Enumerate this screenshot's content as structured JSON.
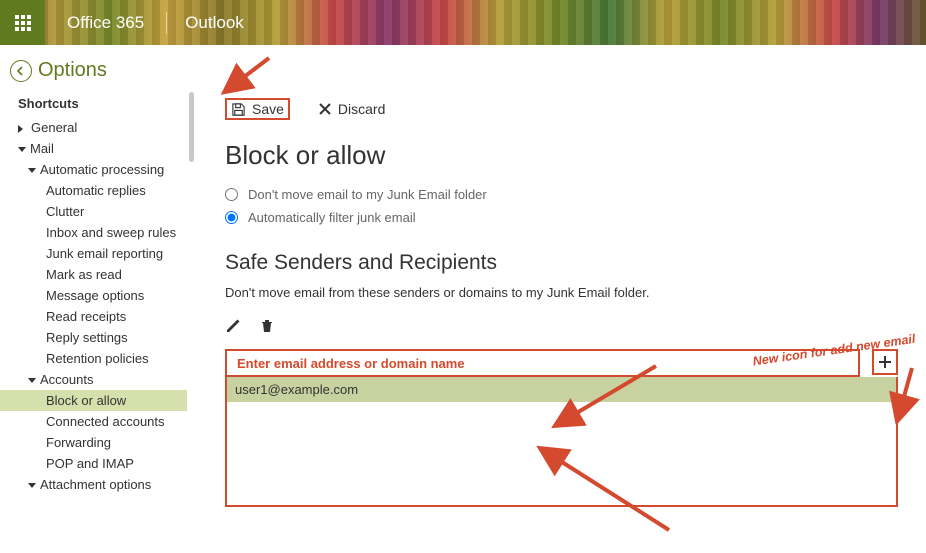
{
  "header": {
    "brand": "Office 365",
    "app": "Outlook"
  },
  "title": "Options",
  "sidebar": {
    "shortcuts_label": "Shortcuts",
    "general_label": "General",
    "mail_label": "Mail",
    "automatic_processing": "Automatic processing",
    "auto_items": [
      "Automatic replies",
      "Clutter",
      "Inbox and sweep rules",
      "Junk email reporting",
      "Mark as read",
      "Message options",
      "Read receipts",
      "Reply settings",
      "Retention policies"
    ],
    "accounts_label": "Accounts",
    "accounts_items": [
      "Block or allow",
      "Connected accounts",
      "Forwarding",
      "POP and IMAP"
    ],
    "attachment_label": "Attachment options"
  },
  "toolbar": {
    "save": "Save",
    "discard": "Discard"
  },
  "section": {
    "title": "Block or allow",
    "radio1": "Don't move email to my Junk Email folder",
    "radio2": "Automatically filter junk email",
    "radio_selected": "2",
    "subhead": "Safe Senders and Recipients",
    "subdesc": "Don't move email from these senders or domains to my Junk Email folder.",
    "input_placeholder": "Enter email address or domain name",
    "list": [
      "user1@example.com"
    ]
  },
  "annotations": {
    "add_label": "New icon for add new email"
  }
}
